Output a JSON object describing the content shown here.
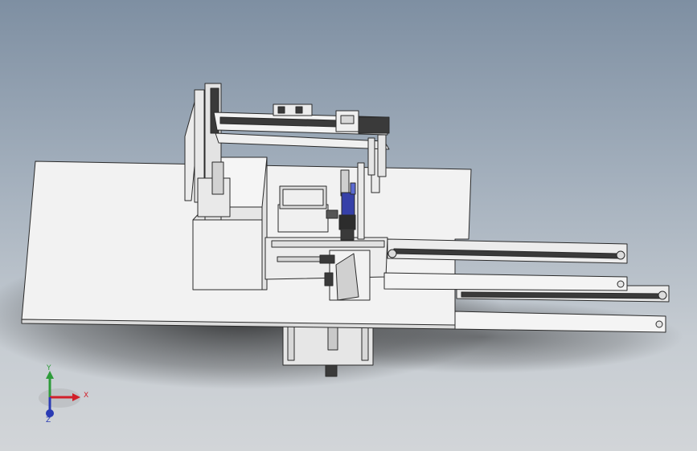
{
  "viewport": {
    "background_top": "#7e8fa2",
    "background_bottom": "#d2d5d8",
    "model_colors": {
      "base_plate": "#f2f2f2",
      "edges": "#2a2a2a",
      "rails": "#3a3a3a",
      "accent_blue": "#3640a8"
    }
  },
  "triad": {
    "x_label": "X",
    "y_label": "Y",
    "z_label": "Z",
    "x_color": "#d1202a",
    "y_color": "#2e9b3a",
    "z_color": "#2a3bb4"
  }
}
